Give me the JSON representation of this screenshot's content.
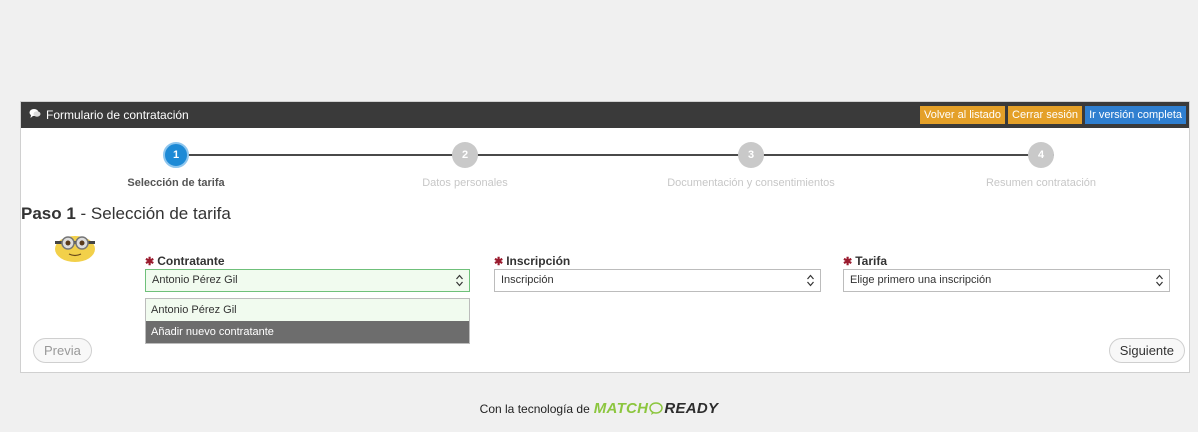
{
  "header": {
    "title": "Formulario de contratación",
    "icon": "chat-bubbles-icon",
    "buttons": [
      {
        "label": "Volver al listado",
        "color": "#e4a028"
      },
      {
        "label": "Cerrar sesión",
        "color": "#e4a028"
      },
      {
        "label": "Ir versión completa",
        "color": "#2f7fd0"
      }
    ]
  },
  "steps": [
    {
      "number": "1",
      "label": "Selección de tarifa",
      "active": true
    },
    {
      "number": "2",
      "label": "Datos personales",
      "active": false
    },
    {
      "number": "3",
      "label": "Documentación y consentimientos",
      "active": false
    },
    {
      "number": "4",
      "label": "Resumen contratación",
      "active": false
    }
  ],
  "step_title": {
    "prefix": "Paso 1",
    "text": " - Selección de tarifa"
  },
  "fields": {
    "contratante": {
      "label": "Contratante",
      "value": "Antonio Pérez Gil"
    },
    "inscripcion": {
      "label": "Inscripción",
      "value": "Inscripción"
    },
    "tarifa": {
      "label": "Tarifa",
      "value": "Elige primero una inscripción"
    }
  },
  "dropdown": {
    "options": [
      "Antonio Pérez Gil",
      "Añadir nuevo contratante"
    ],
    "highlighted": "Añadir nuevo contratante"
  },
  "nav": {
    "prev": "Previa",
    "next": "Siguiente"
  },
  "footer": {
    "text": "Con la tecnología de",
    "brand_part1": "MATCH",
    "brand_part2": "READY"
  },
  "colors": {
    "accent": "#1d8ad6",
    "required": "#9a1b2e",
    "brand_green": "#8cc63f"
  }
}
